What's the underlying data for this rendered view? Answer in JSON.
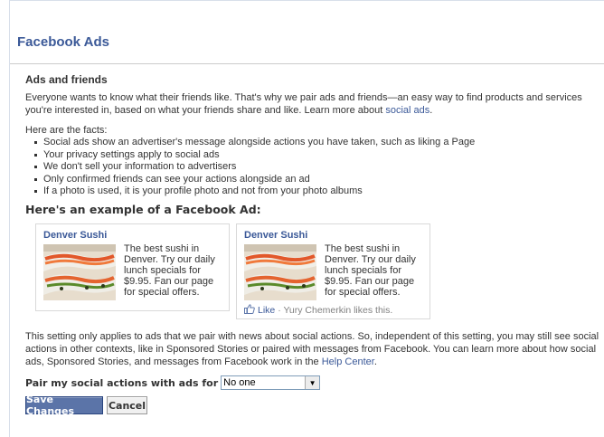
{
  "header": {
    "title": "Facebook Ads"
  },
  "section": {
    "title": "Ads and friends",
    "intro": "Everyone wants to know what their friends like. That's why we pair ads and friends—an easy way to find products and services you're interested in, based on what your friends share and like. Learn more about ",
    "intro_link": "social ads",
    "intro_end": ".",
    "facts_heading": "Here are the facts:",
    "facts": [
      "Social ads show an advertiser's message alongside actions you have taken, such as liking a Page",
      "Your privacy settings apply to social ads",
      "We don't sell your information to advertisers",
      "Only confirmed friends can see your actions alongside an ad",
      "If a photo is used, it is your profile photo and not from your photo albums"
    ]
  },
  "example": {
    "title": "Here's an example of a Facebook Ad:",
    "ads": [
      {
        "name": "Denver Sushi",
        "text": "The best sushi in Denver. Try our daily lunch specials for $9.95. Fan our page for special offers."
      },
      {
        "name": "Denver Sushi",
        "text": "The best sushi in Denver. Try our daily lunch specials for $9.95. Fan our page for special offers.",
        "like_label": "Like",
        "like_text": "· Yury Chemerkin likes this."
      }
    ]
  },
  "note": {
    "text": "This setting only applies to ads that we pair with news about social actions. So, independent of this setting, you may still see social actions in other contexts, like in Sponsored Stories or paired with messages from Facebook. You can learn more about how social ads, Sponsored Stories, and messages from Facebook work in the ",
    "link": "Help Center",
    "end": "."
  },
  "setting": {
    "label": "Pair my social actions with ads for",
    "selected": "No one"
  },
  "buttons": {
    "save": "Save Changes",
    "cancel": "Cancel"
  },
  "colors": {
    "brand": "#3b5998",
    "button": "#5b74a8"
  }
}
